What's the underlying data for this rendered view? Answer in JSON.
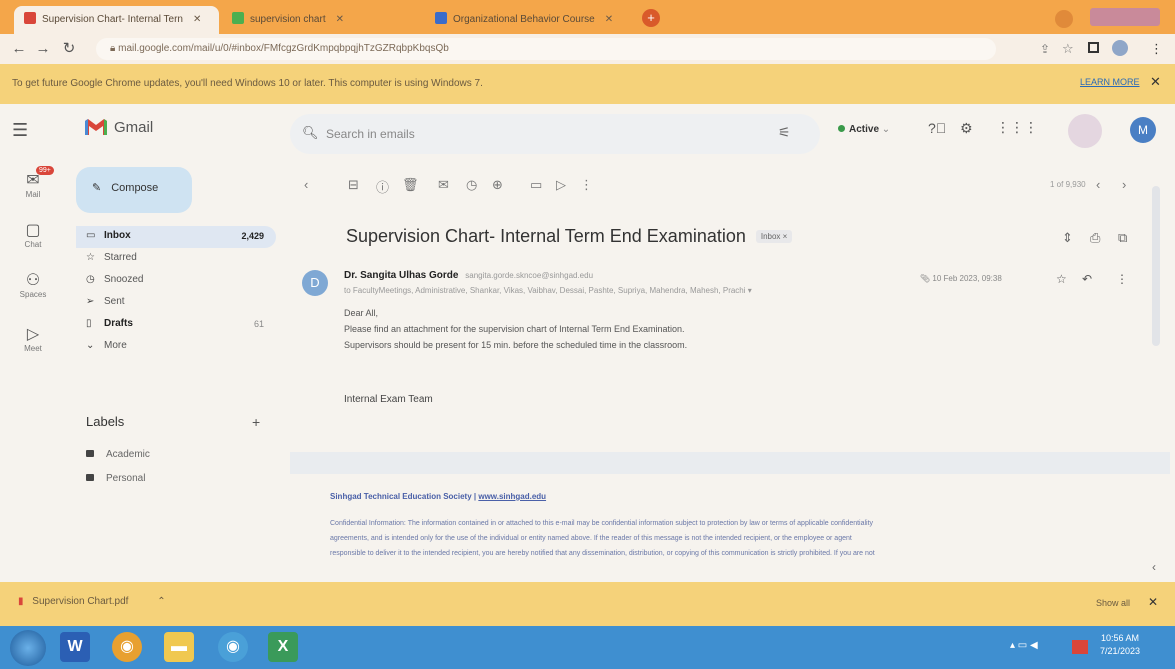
{
  "browser": {
    "tabs": [
      {
        "title": "Supervision Chart- Internal Tern",
        "favicon_color": "#d9463a"
      },
      {
        "title": "supervision chart",
        "favicon_color": "#4caf50"
      },
      {
        "title": "Organizational Behavior Course",
        "favicon_color": "#3b6cc9"
      }
    ],
    "new_tab": "+",
    "url": "mail.google.com/mail/u/0/#inbox/FMfcgzGrdKmpqbpqjhTzGZRqbpKbqsQb",
    "infobar_text": "To get future Google Chrome updates, you'll need Windows 10 or later. This computer is using Windows 7.",
    "learn_more": "LEARN MORE"
  },
  "gmail": {
    "app_name": "Gmail",
    "search_placeholder": "Search in emails",
    "status": "Active",
    "profile_initial": "M",
    "rail": [
      {
        "label": "Mail",
        "badge": "99+"
      },
      {
        "label": "Chat"
      },
      {
        "label": "Spaces"
      },
      {
        "label": "Meet"
      }
    ],
    "compose_label": "Compose",
    "nav": [
      {
        "label": "Inbox",
        "count": "2,429",
        "selected": true
      },
      {
        "label": "Starred"
      },
      {
        "label": "Snoozed"
      },
      {
        "label": "Sent"
      },
      {
        "label": "Drafts",
        "count": "61"
      },
      {
        "label": "More"
      }
    ],
    "labels_title": "Labels",
    "labels_add": "+",
    "labels": [
      "Academic",
      "Personal"
    ],
    "pager": "1 of 9,930"
  },
  "email": {
    "subject": "Supervision Chart- Internal Term End Examination",
    "tag": "Inbox ×",
    "sender_initial": "D",
    "sender_name": "Dr. Sangita Ulhas Gorde",
    "sender_email": "sangita.gorde.skncoe@sinhgad.edu",
    "to_line": "to FacultyMeetings, Administrative, Shankar, Vikas, Vaibhav, Dessai, Pashte, Supriya, Mahendra, Mahesh, Prachi",
    "date": "10 Feb 2023, 09:38",
    "body_lines": [
      "Dear All,",
      "Please find an attachment for the supervision chart of Internal Term End Examination.",
      "Supervisors should be present for 15 min. before the scheduled time in the classroom."
    ],
    "signature": "Internal Exam Team",
    "footer_org": "Sinhgad Technical Education Society",
    "footer_link": "www.sinhgad.edu",
    "footer_lines": [
      "Confidential Information: The information contained in or attached to this e-mail may be confidential information subject to protection by law or terms of applicable confidentiality",
      "agreements, and is intended only for the use of the individual or entity named above. If the reader of this message is not the intended recipient, or the employee or agent",
      "responsible to deliver it to the intended recipient, you are hereby notified that any dissemination, distribution, or copying of this communication is strictly prohibited. If you are not"
    ]
  },
  "download": {
    "file": "Supervision Chart.pdf",
    "show_all": "Show all"
  },
  "taskbar": {
    "time": "10:56 AM",
    "date": "7/21/2023"
  }
}
